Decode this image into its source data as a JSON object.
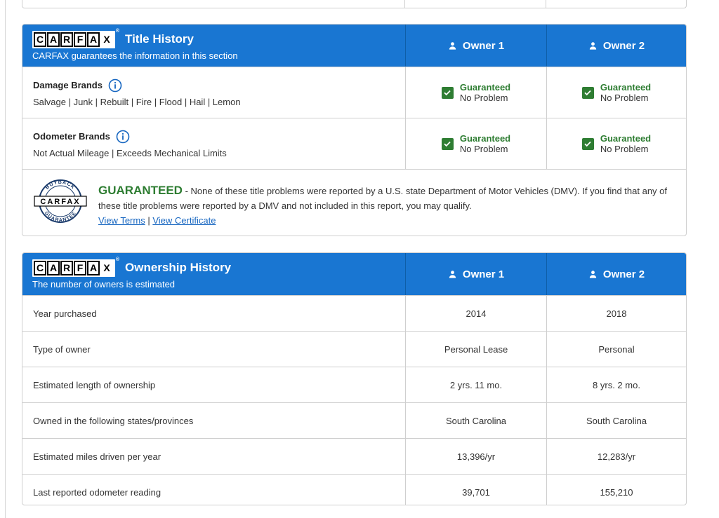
{
  "title_history": {
    "logo_text": "CARFAX",
    "title": "Title History",
    "subtitle": "CARFAX guarantees the information in this section",
    "owners": [
      "Owner 1",
      "Owner 2"
    ],
    "brands": [
      {
        "name": "Damage Brands",
        "description": "Salvage | Junk | Rebuilt | Fire | Flood | Hail | Lemon",
        "owner1": {
          "status": "Guaranteed",
          "value": "No Problem"
        },
        "owner2": {
          "status": "Guaranteed",
          "value": "No Problem"
        }
      },
      {
        "name": "Odometer Brands",
        "description": "Not Actual Mileage | Exceeds Mechanical Limits",
        "owner1": {
          "status": "Guaranteed",
          "value": "No Problem"
        },
        "owner2": {
          "status": "Guaranteed",
          "value": "No Problem"
        }
      }
    ],
    "guarantee": {
      "badge_top": "BUYBACK",
      "badge_bottom": "GUARANTEE",
      "badge_logo": "CARFAX",
      "word": "GUARANTEED",
      "text": "- None of these title problems were reported by a U.S. state Department of Motor Vehicles (DMV). If you find that any of these title problems were reported by a DMV and not included in this report, you may qualify.",
      "view_terms": "View Terms",
      "separator": "|",
      "view_certificate": "View Certificate"
    }
  },
  "ownership_history": {
    "logo_text": "CARFAX",
    "title": "Ownership History",
    "subtitle": "The number of owners is estimated",
    "owners": [
      "Owner 1",
      "Owner 2"
    ],
    "rows": [
      {
        "label": "Year purchased",
        "owner1": "2014",
        "owner2": "2018"
      },
      {
        "label": "Type of owner",
        "owner1": "Personal Lease",
        "owner2": "Personal"
      },
      {
        "label": "Estimated length of ownership",
        "owner1": "2 yrs. 11 mo.",
        "owner2": "8 yrs. 2 mo."
      },
      {
        "label": "Owned in the following states/provinces",
        "owner1": "South Carolina",
        "owner2": "South Carolina"
      },
      {
        "label": "Estimated miles driven per year",
        "owner1": "13,396/yr",
        "owner2": "12,283/yr"
      },
      {
        "label": "Last reported odometer reading",
        "owner1": "39,701",
        "owner2": "155,210"
      }
    ]
  },
  "colors": {
    "header_blue": "#1976d2",
    "guarantee_green": "#2e7d32",
    "link_blue": "#1565c0"
  }
}
